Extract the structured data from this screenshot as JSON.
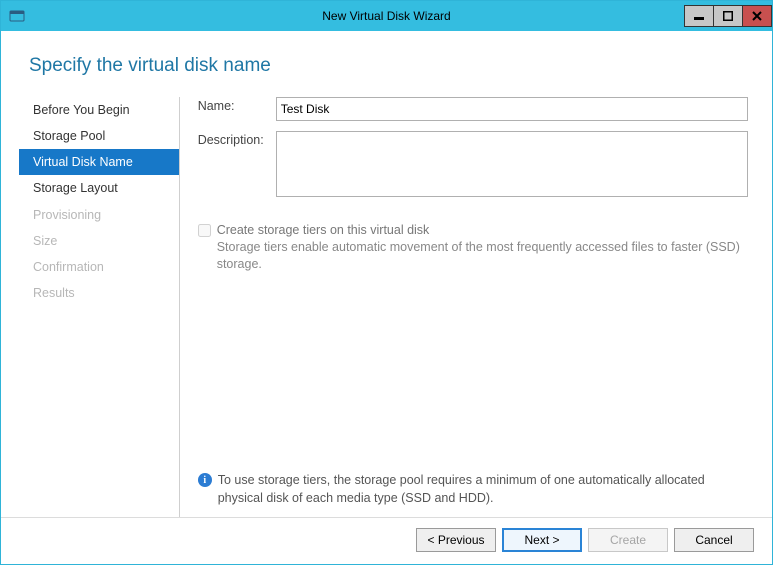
{
  "window": {
    "title": "New Virtual Disk Wizard"
  },
  "heading": "Specify the virtual disk name",
  "nav": {
    "items": [
      {
        "label": "Before You Begin",
        "state": "normal"
      },
      {
        "label": "Storage Pool",
        "state": "normal"
      },
      {
        "label": "Virtual Disk Name",
        "state": "selected"
      },
      {
        "label": "Storage Layout",
        "state": "normal"
      },
      {
        "label": "Provisioning",
        "state": "disabled"
      },
      {
        "label": "Size",
        "state": "disabled"
      },
      {
        "label": "Confirmation",
        "state": "disabled"
      },
      {
        "label": "Results",
        "state": "disabled"
      }
    ]
  },
  "form": {
    "name_label": "Name:",
    "name_value": "Test Disk",
    "desc_label": "Description:",
    "desc_value": "",
    "tier_checkbox": {
      "checked": false,
      "enabled": false,
      "label": "Create storage tiers on this virtual disk",
      "desc": "Storage tiers enable automatic movement of the most frequently accessed files to faster (SSD) storage."
    }
  },
  "note": {
    "icon": "i",
    "text": "To use storage tiers, the storage pool requires a minimum of one automatically allocated physical disk of each media type (SSD and HDD)."
  },
  "footer": {
    "previous": "< Previous",
    "next": "Next >",
    "create": "Create",
    "cancel": "Cancel"
  }
}
